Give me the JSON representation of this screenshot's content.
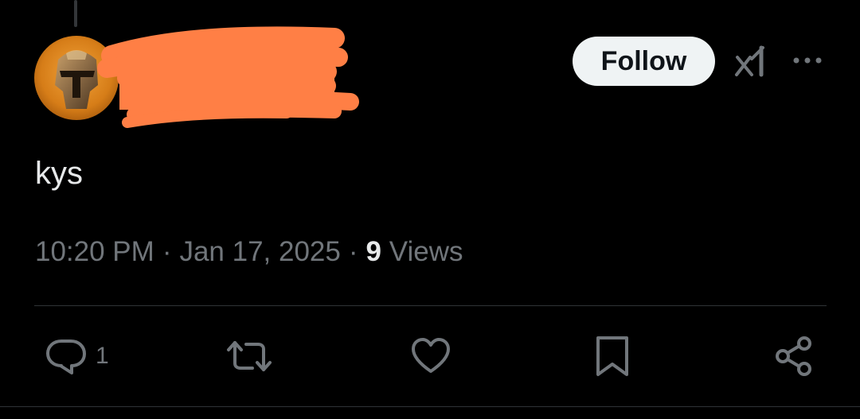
{
  "post": {
    "text": "kys",
    "time": "10:20 PM",
    "separator": "·",
    "date": "Jan 17, 2025",
    "views_count": "9",
    "views_label": "Views"
  },
  "header": {
    "follow_label": "Follow",
    "icons": [
      "grok-icon",
      "more-icon"
    ]
  },
  "actions": {
    "reply_count": "1",
    "icons": [
      "reply-icon",
      "repost-icon",
      "like-icon",
      "bookmark-icon",
      "share-icon"
    ]
  },
  "colors": {
    "background": "#000000",
    "text_primary": "#e7e9ea",
    "text_secondary": "#71767b",
    "follow_bg": "#eff3f4",
    "divider": "#2f3336",
    "redaction": "#ff7f45"
  }
}
